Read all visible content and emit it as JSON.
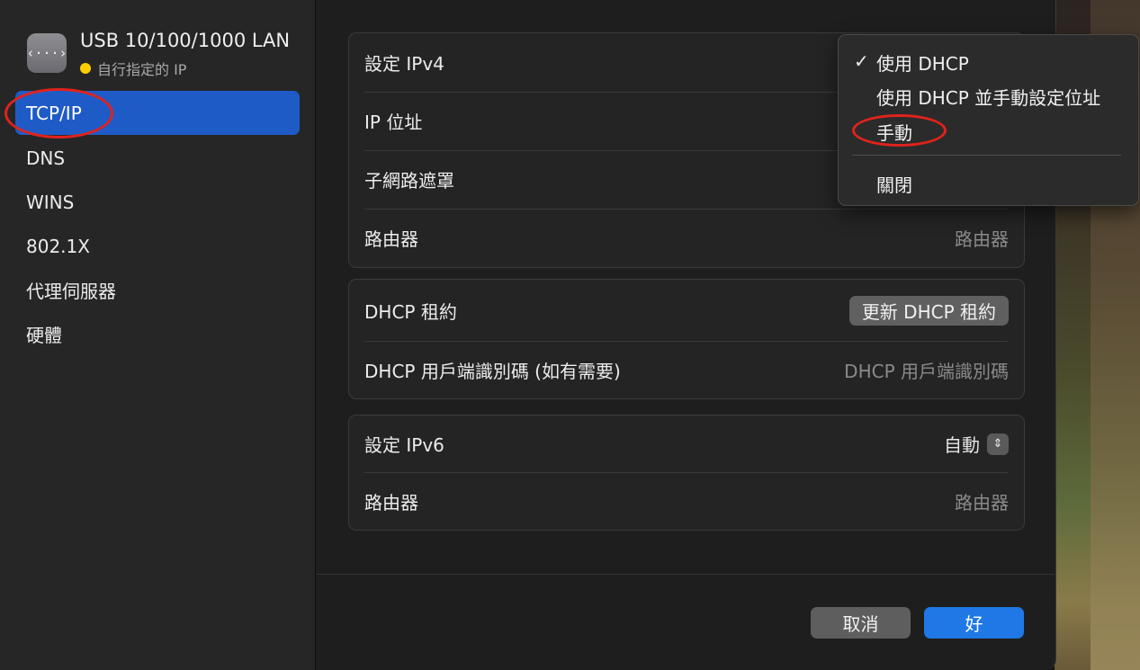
{
  "sidebar": {
    "interface_icon": "network-interface-icon",
    "interface_icon_glyph": "‹···›",
    "interface_name": "USB 10/100/1000 LAN",
    "interface_status": "自行指定的 IP",
    "status_color": "#ffcc00",
    "items": [
      {
        "label": "TCP/IP",
        "selected": true
      },
      {
        "label": "DNS"
      },
      {
        "label": "WINS"
      },
      {
        "label": "802.1X"
      },
      {
        "label": "代理伺服器"
      },
      {
        "label": "硬體"
      }
    ]
  },
  "ipv4": {
    "configure_label": "設定 IPv4",
    "ip_label": "IP 位址",
    "subnet_label": "子網路遮罩",
    "router_label": "路由器",
    "router_placeholder": "路由器"
  },
  "dhcp": {
    "lease_label": "DHCP 租約",
    "renew_button": "更新 DHCP 租約",
    "client_id_label": "DHCP 用戶端識別碼 (如有需要)",
    "client_id_placeholder": "DHCP 用戶端識別碼"
  },
  "ipv6": {
    "configure_label": "設定 IPv6",
    "configure_value": "自動",
    "router_label": "路由器",
    "router_placeholder": "路由器"
  },
  "footer": {
    "cancel": "取消",
    "ok": "好"
  },
  "popup_menu": {
    "checkmark": "✓",
    "items": [
      "使用 DHCP",
      "使用 DHCP 並手動設定位址",
      "手動",
      "關閉"
    ],
    "selected": "使用 DHCP"
  },
  "colors": {
    "accent": "#1f5bc7",
    "ok_button": "#1f78e5",
    "annotation": "#e0231c"
  }
}
